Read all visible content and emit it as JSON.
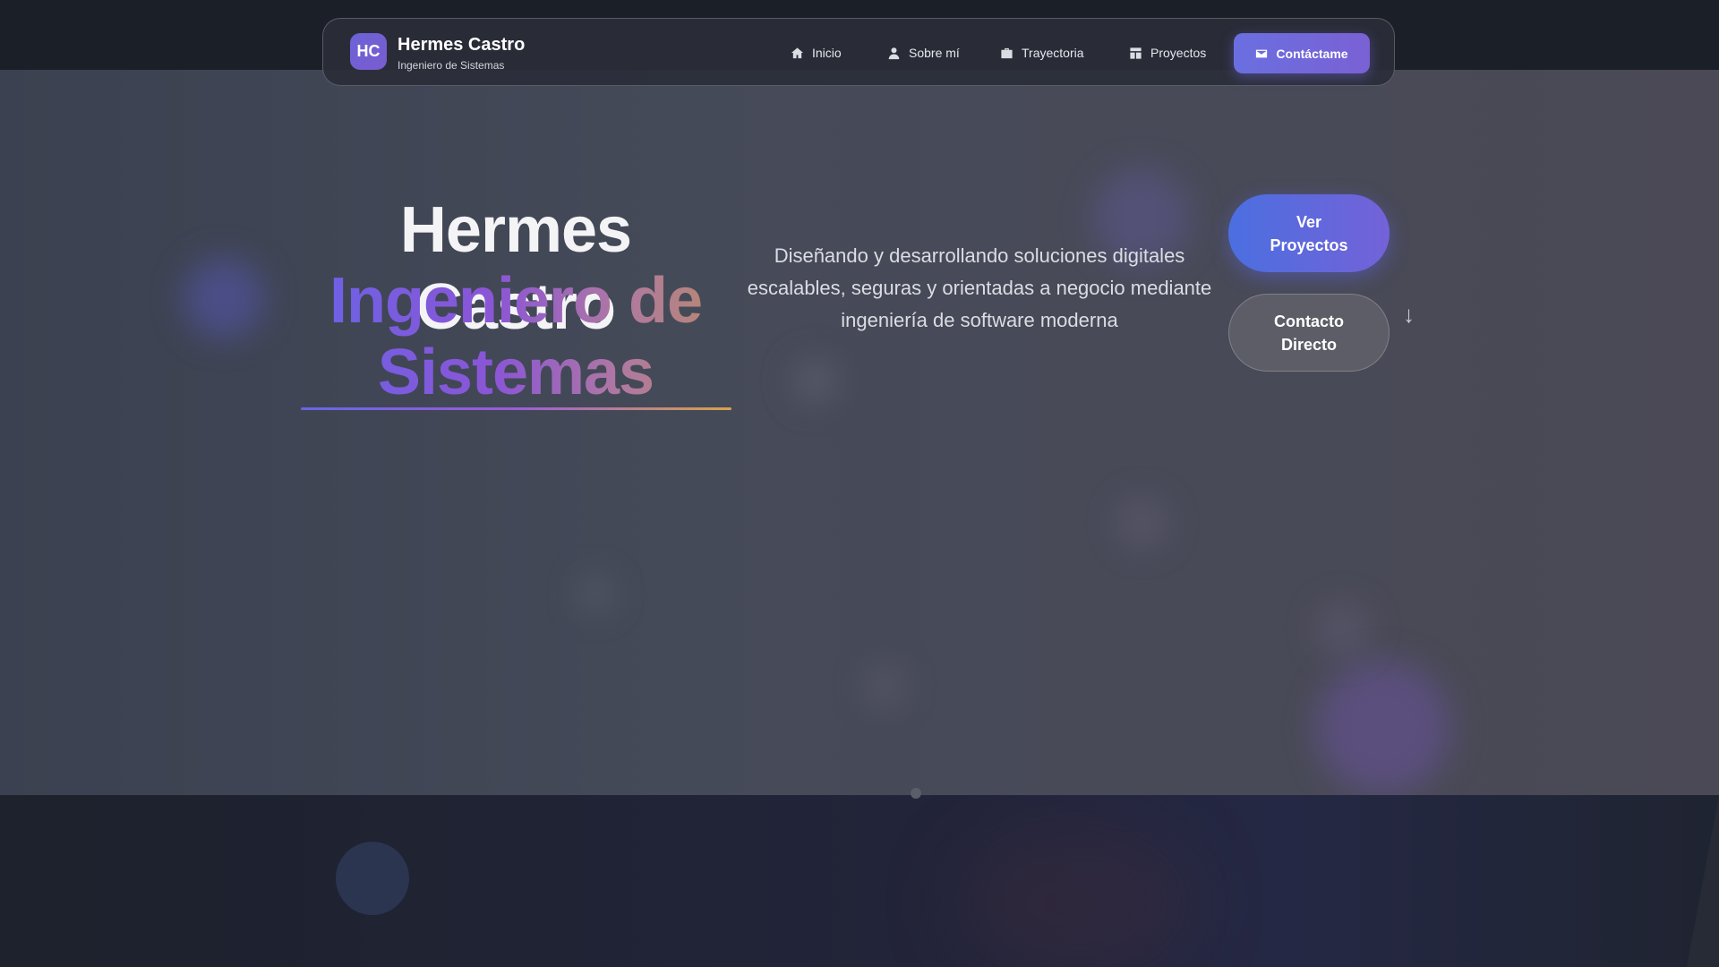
{
  "brand": {
    "logo_initials": "HC",
    "name": "Hermes Castro",
    "role": "Ingeniero de Sistemas"
  },
  "nav": {
    "items": [
      {
        "label": "Inicio",
        "icon": "home-icon"
      },
      {
        "label": "Sobre mí",
        "icon": "user-icon"
      },
      {
        "label": "Trayectoria",
        "icon": "briefcase-icon"
      },
      {
        "label": "Proyectos",
        "icon": "projects-icon"
      }
    ],
    "cta": {
      "label": "Contáctame",
      "icon": "mail-icon"
    }
  },
  "hero": {
    "name": "Hermes Castro",
    "role_line1": "Ingeniero de",
    "role_line2": "Sistemas",
    "description": "Diseñando y desarrollando soluciones digitales escalables, seguras y orientadas a negocio mediante ingeniería de software moderna",
    "primary_button": "Ver Proyectos",
    "secondary_button": "Contacto Directo",
    "scroll_hint": "↓"
  },
  "colors": {
    "accent": "#6a6fe0",
    "accent_purple": "#7a61d4",
    "background": "#1c212b",
    "hero_background": "#454a59"
  }
}
